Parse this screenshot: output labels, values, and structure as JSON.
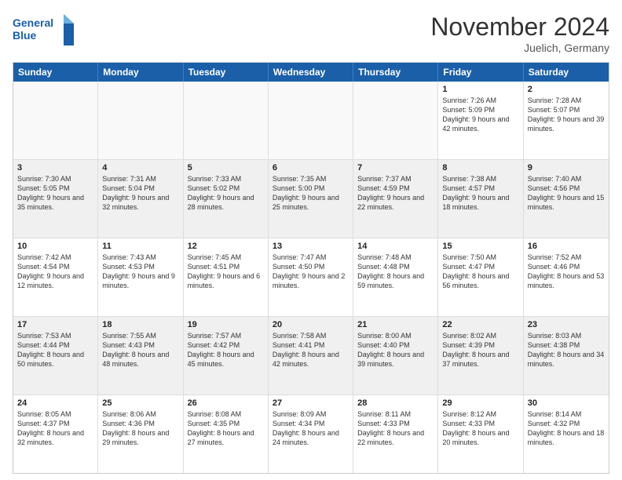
{
  "logo": {
    "text_line1": "General",
    "text_line2": "Blue"
  },
  "header": {
    "month_title": "November 2024",
    "location": "Juelich, Germany"
  },
  "weekdays": [
    "Sunday",
    "Monday",
    "Tuesday",
    "Wednesday",
    "Thursday",
    "Friday",
    "Saturday"
  ],
  "weeks": [
    [
      {
        "day": "",
        "info": "",
        "empty": true
      },
      {
        "day": "",
        "info": "",
        "empty": true
      },
      {
        "day": "",
        "info": "",
        "empty": true
      },
      {
        "day": "",
        "info": "",
        "empty": true
      },
      {
        "day": "",
        "info": "",
        "empty": true
      },
      {
        "day": "1",
        "info": "Sunrise: 7:26 AM\nSunset: 5:09 PM\nDaylight: 9 hours and 42 minutes."
      },
      {
        "day": "2",
        "info": "Sunrise: 7:28 AM\nSunset: 5:07 PM\nDaylight: 9 hours and 39 minutes."
      }
    ],
    [
      {
        "day": "3",
        "info": "Sunrise: 7:30 AM\nSunset: 5:05 PM\nDaylight: 9 hours and 35 minutes."
      },
      {
        "day": "4",
        "info": "Sunrise: 7:31 AM\nSunset: 5:04 PM\nDaylight: 9 hours and 32 minutes."
      },
      {
        "day": "5",
        "info": "Sunrise: 7:33 AM\nSunset: 5:02 PM\nDaylight: 9 hours and 28 minutes."
      },
      {
        "day": "6",
        "info": "Sunrise: 7:35 AM\nSunset: 5:00 PM\nDaylight: 9 hours and 25 minutes."
      },
      {
        "day": "7",
        "info": "Sunrise: 7:37 AM\nSunset: 4:59 PM\nDaylight: 9 hours and 22 minutes."
      },
      {
        "day": "8",
        "info": "Sunrise: 7:38 AM\nSunset: 4:57 PM\nDaylight: 9 hours and 18 minutes."
      },
      {
        "day": "9",
        "info": "Sunrise: 7:40 AM\nSunset: 4:56 PM\nDaylight: 9 hours and 15 minutes."
      }
    ],
    [
      {
        "day": "10",
        "info": "Sunrise: 7:42 AM\nSunset: 4:54 PM\nDaylight: 9 hours and 12 minutes."
      },
      {
        "day": "11",
        "info": "Sunrise: 7:43 AM\nSunset: 4:53 PM\nDaylight: 9 hours and 9 minutes."
      },
      {
        "day": "12",
        "info": "Sunrise: 7:45 AM\nSunset: 4:51 PM\nDaylight: 9 hours and 6 minutes."
      },
      {
        "day": "13",
        "info": "Sunrise: 7:47 AM\nSunset: 4:50 PM\nDaylight: 9 hours and 2 minutes."
      },
      {
        "day": "14",
        "info": "Sunrise: 7:48 AM\nSunset: 4:48 PM\nDaylight: 8 hours and 59 minutes."
      },
      {
        "day": "15",
        "info": "Sunrise: 7:50 AM\nSunset: 4:47 PM\nDaylight: 8 hours and 56 minutes."
      },
      {
        "day": "16",
        "info": "Sunrise: 7:52 AM\nSunset: 4:46 PM\nDaylight: 8 hours and 53 minutes."
      }
    ],
    [
      {
        "day": "17",
        "info": "Sunrise: 7:53 AM\nSunset: 4:44 PM\nDaylight: 8 hours and 50 minutes."
      },
      {
        "day": "18",
        "info": "Sunrise: 7:55 AM\nSunset: 4:43 PM\nDaylight: 8 hours and 48 minutes."
      },
      {
        "day": "19",
        "info": "Sunrise: 7:57 AM\nSunset: 4:42 PM\nDaylight: 8 hours and 45 minutes."
      },
      {
        "day": "20",
        "info": "Sunrise: 7:58 AM\nSunset: 4:41 PM\nDaylight: 8 hours and 42 minutes."
      },
      {
        "day": "21",
        "info": "Sunrise: 8:00 AM\nSunset: 4:40 PM\nDaylight: 8 hours and 39 minutes."
      },
      {
        "day": "22",
        "info": "Sunrise: 8:02 AM\nSunset: 4:39 PM\nDaylight: 8 hours and 37 minutes."
      },
      {
        "day": "23",
        "info": "Sunrise: 8:03 AM\nSunset: 4:38 PM\nDaylight: 8 hours and 34 minutes."
      }
    ],
    [
      {
        "day": "24",
        "info": "Sunrise: 8:05 AM\nSunset: 4:37 PM\nDaylight: 8 hours and 32 minutes."
      },
      {
        "day": "25",
        "info": "Sunrise: 8:06 AM\nSunset: 4:36 PM\nDaylight: 8 hours and 29 minutes."
      },
      {
        "day": "26",
        "info": "Sunrise: 8:08 AM\nSunset: 4:35 PM\nDaylight: 8 hours and 27 minutes."
      },
      {
        "day": "27",
        "info": "Sunrise: 8:09 AM\nSunset: 4:34 PM\nDaylight: 8 hours and 24 minutes."
      },
      {
        "day": "28",
        "info": "Sunrise: 8:11 AM\nSunset: 4:33 PM\nDaylight: 8 hours and 22 minutes."
      },
      {
        "day": "29",
        "info": "Sunrise: 8:12 AM\nSunset: 4:33 PM\nDaylight: 8 hours and 20 minutes."
      },
      {
        "day": "30",
        "info": "Sunrise: 8:14 AM\nSunset: 4:32 PM\nDaylight: 8 hours and 18 minutes."
      }
    ]
  ]
}
